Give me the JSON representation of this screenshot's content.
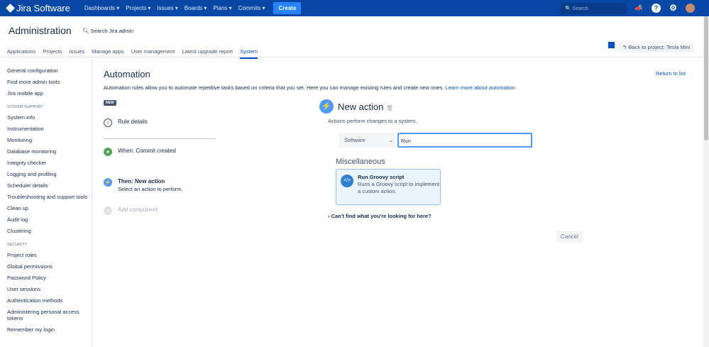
{
  "topbar": {
    "logo": "Jira Software",
    "nav": [
      "Dashboards",
      "Projects",
      "Issues",
      "Boards",
      "Plans",
      "Commits"
    ],
    "create": "Create",
    "search_placeholder": "Search"
  },
  "header": {
    "title": "Administration",
    "search": "Search Jira admin",
    "back": "Back to project: Tesla Mini",
    "tabs": [
      "Applications",
      "Projects",
      "Issues",
      "Manage apps",
      "User management",
      "Latest upgrade report",
      "System"
    ]
  },
  "sidebar": {
    "top": [
      "General configuration",
      "Find more admin tools",
      "Jira mobile app"
    ],
    "support_title": "SYSTEM SUPPORT",
    "support": [
      "System info",
      "Instrumentation",
      "Monitoring",
      "Database monitoring",
      "Integrity checker",
      "Logging and profiling",
      "Scheduler details",
      "Troubleshooting and support tools",
      "Clean up",
      "Audit log",
      "Clustering"
    ],
    "security_title": "SECURITY",
    "security": [
      "Project roles",
      "Global permissions",
      "Password Policy",
      "User sessions",
      "Authentication methods",
      "Administering personal access tokens",
      "Remember my login"
    ]
  },
  "main": {
    "title": "Automation",
    "desc": "Automation rules allow you to automate repetitive tasks based on criteria that you set. Here you can manage existing rules and create new ones.",
    "learn": "Learn more about automation",
    "return": "Return to list",
    "badge": "NEW",
    "steps": {
      "details": "Rule details",
      "when": "When: Commit created",
      "then": "Then: New action",
      "then_sub": "Select an action to perform.",
      "add": "Add component"
    },
    "action": {
      "title": "New action",
      "sub": "Actions perform changes to a system.",
      "select": "Software",
      "input": "Run",
      "category": "Miscellaneous",
      "card_title": "Run Groovy script",
      "card_desc": "Runs a Groovy script to implement a custom action.",
      "cant_find": "Can't find what you're looking for here?",
      "cancel": "Cancel"
    }
  }
}
